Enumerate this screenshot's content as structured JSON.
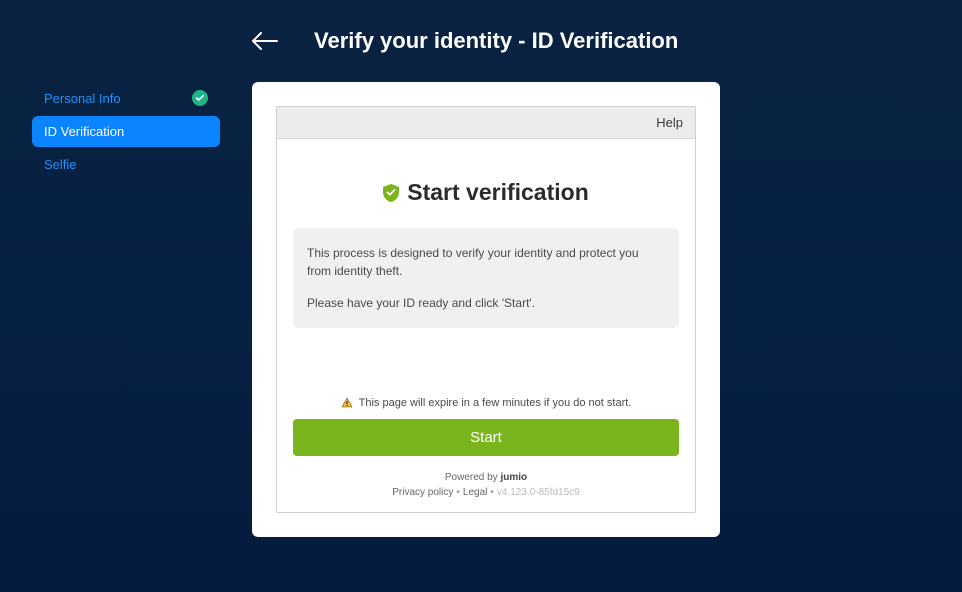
{
  "header": {
    "title": "Verify your identity - ID Verification"
  },
  "sidebar": {
    "items": [
      {
        "label": "Personal Info",
        "state": "completed"
      },
      {
        "label": "ID Verification",
        "state": "active"
      },
      {
        "label": "Selfie",
        "state": "pending"
      }
    ]
  },
  "panel": {
    "help_label": "Help",
    "heading": "Start verification",
    "info_line1": "This process is designed to verify your identity and protect you from identity theft.",
    "info_line2": "Please have your ID ready and click 'Start'.",
    "expire_warning": "This page will expire in a few minutes if you do not start.",
    "start_button": "Start",
    "powered_by_prefix": "Powered by ",
    "powered_by_brand": "jumio",
    "privacy_label": "Privacy policy",
    "legal_label": "Legal",
    "version": "v4.123.0-85fd15c9"
  },
  "colors": {
    "accent_blue": "#0b84ff",
    "accent_green": "#7ab51d",
    "badge_teal": "#1db584",
    "bg_dark": "#0a2342"
  }
}
